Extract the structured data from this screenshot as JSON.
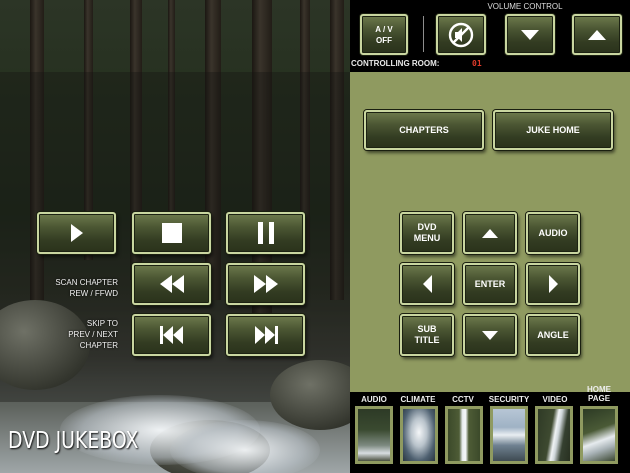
{
  "brand": {
    "title": "DVD JUKEBOX"
  },
  "header": {
    "av_off": "A / V\nOFF",
    "volume_label": "VOLUME CONTROL",
    "controlling_label": "CONTROLLING ROOM:",
    "room_number": "01"
  },
  "panel": {
    "chapters": "CHAPTERS",
    "juke_home": "JUKE HOME",
    "dvd_menu": "DVD\nMENU",
    "audio": "AUDIO",
    "enter": "ENTER",
    "subtitle": "SUB\nTITLE",
    "angle": "ANGLE"
  },
  "transport": {
    "scan_label": "SCAN CHAPTER\nREW / FFWD",
    "skip_label": "SKIP TO\nPREV / NEXT\nCHAPTER"
  },
  "nav": [
    {
      "label": "AUDIO",
      "icon": "forest-stream-thumb"
    },
    {
      "label": "CLIMATE",
      "icon": "waterfall-thumb"
    },
    {
      "label": "CCTV",
      "icon": "tall-waterfall-thumb"
    },
    {
      "label": "SECURITY",
      "icon": "coast-thumb"
    },
    {
      "label": "VIDEO",
      "icon": "cascade-thumb"
    },
    {
      "label": "HOME\nPAGE",
      "icon": "creek-thumb"
    }
  ],
  "colors": {
    "panel": "#8f9a60",
    "button_border": "#c9d6a0",
    "room_number": "#e03a2a"
  }
}
